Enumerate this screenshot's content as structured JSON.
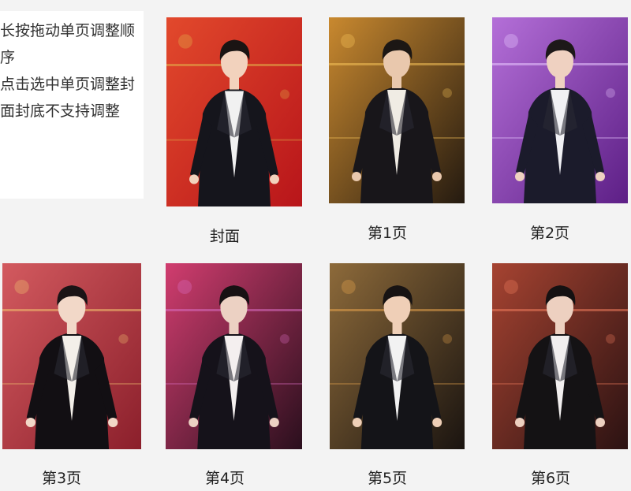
{
  "hint": {
    "text": "长按拖动单页调整顺序\n点击选中单页调整封面封底不支持调整"
  },
  "pages": [
    {
      "label": "封面",
      "bg": "#b8151a",
      "bg2": "#e2492c",
      "suit": "#15151c",
      "shirt": "#f1f1f1",
      "skin": "#f2d2bd",
      "hair": "#1a1413",
      "accent": "#e2b24a"
    },
    {
      "label": "第1页",
      "bg": "#241a10",
      "bg2": "#c9892f",
      "suit": "#18161a",
      "shirt": "#f0ece4",
      "skin": "#e9c8ad",
      "hair": "#1c1714",
      "accent": "#f5c35a"
    },
    {
      "label": "第2页",
      "bg": "#5d1f86",
      "bg2": "#b46fd8",
      "suit": "#1b1b2b",
      "shirt": "#f0f0f4",
      "skin": "#efd1c1",
      "hair": "#1d1819",
      "accent": "#e9c8ff"
    },
    {
      "label": "第3页",
      "bg": "#8b1f2b",
      "bg2": "#d35a5f",
      "suit": "#120f13",
      "shirt": "#f3efe9",
      "skin": "#f2d8c8",
      "hair": "#1b1416",
      "accent": "#f2c36f"
    },
    {
      "label": "第4页",
      "bg": "#2a0f1d",
      "bg2": "#d13d6f",
      "suit": "#15121a",
      "shirt": "#f4efef",
      "skin": "#ecd1c3",
      "hair": "#171113",
      "accent": "#d96ec3"
    },
    {
      "label": "第5页",
      "bg": "#1a1410",
      "bg2": "#8d6a3a",
      "suit": "#141418",
      "shirt": "#f2f2f2",
      "skin": "#efcfb7",
      "hair": "#171313",
      "accent": "#e5a24c"
    },
    {
      "label": "第6页",
      "bg": "#2b1212",
      "bg2": "#a64331",
      "suit": "#141214",
      "shirt": "#f1eeee",
      "skin": "#edd0c0",
      "hair": "#151112",
      "accent": "#ef7c5c"
    }
  ]
}
